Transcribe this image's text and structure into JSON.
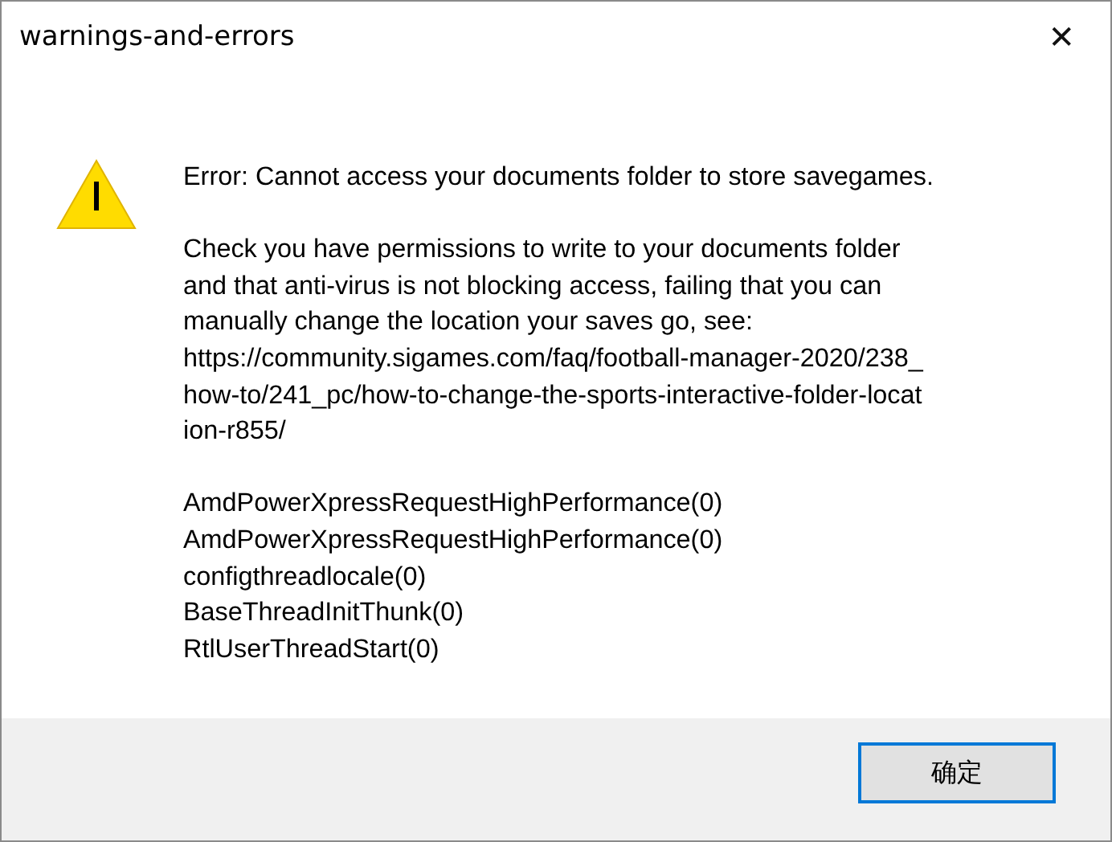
{
  "window": {
    "title": "warnings-and-errors",
    "close": "✕"
  },
  "message": {
    "kind": "warning",
    "blocks": [
      {
        "lines": [
          "Error: Cannot access your documents folder to store savegames."
        ]
      },
      {
        "lines": [
          "Check you have permissions to write to your documents folder",
          "and that anti-virus is not blocking access, failing that you can",
          "manually change the location your saves go, see:",
          "https://community.sigames.com/faq/football-manager-2020/238_",
          "how-to/241_pc/how-to-change-the-sports-interactive-folder-locat",
          "ion-r855/"
        ]
      },
      {
        "lines": [
          "AmdPowerXpressRequestHighPerformance(0)",
          "AmdPowerXpressRequestHighPerformance(0)",
          "configthreadlocale(0)",
          "BaseThreadInitThunk(0)",
          "RtlUserThreadStart(0)"
        ]
      }
    ]
  },
  "buttons": [
    {
      "label": "确定",
      "focused": true
    }
  ]
}
